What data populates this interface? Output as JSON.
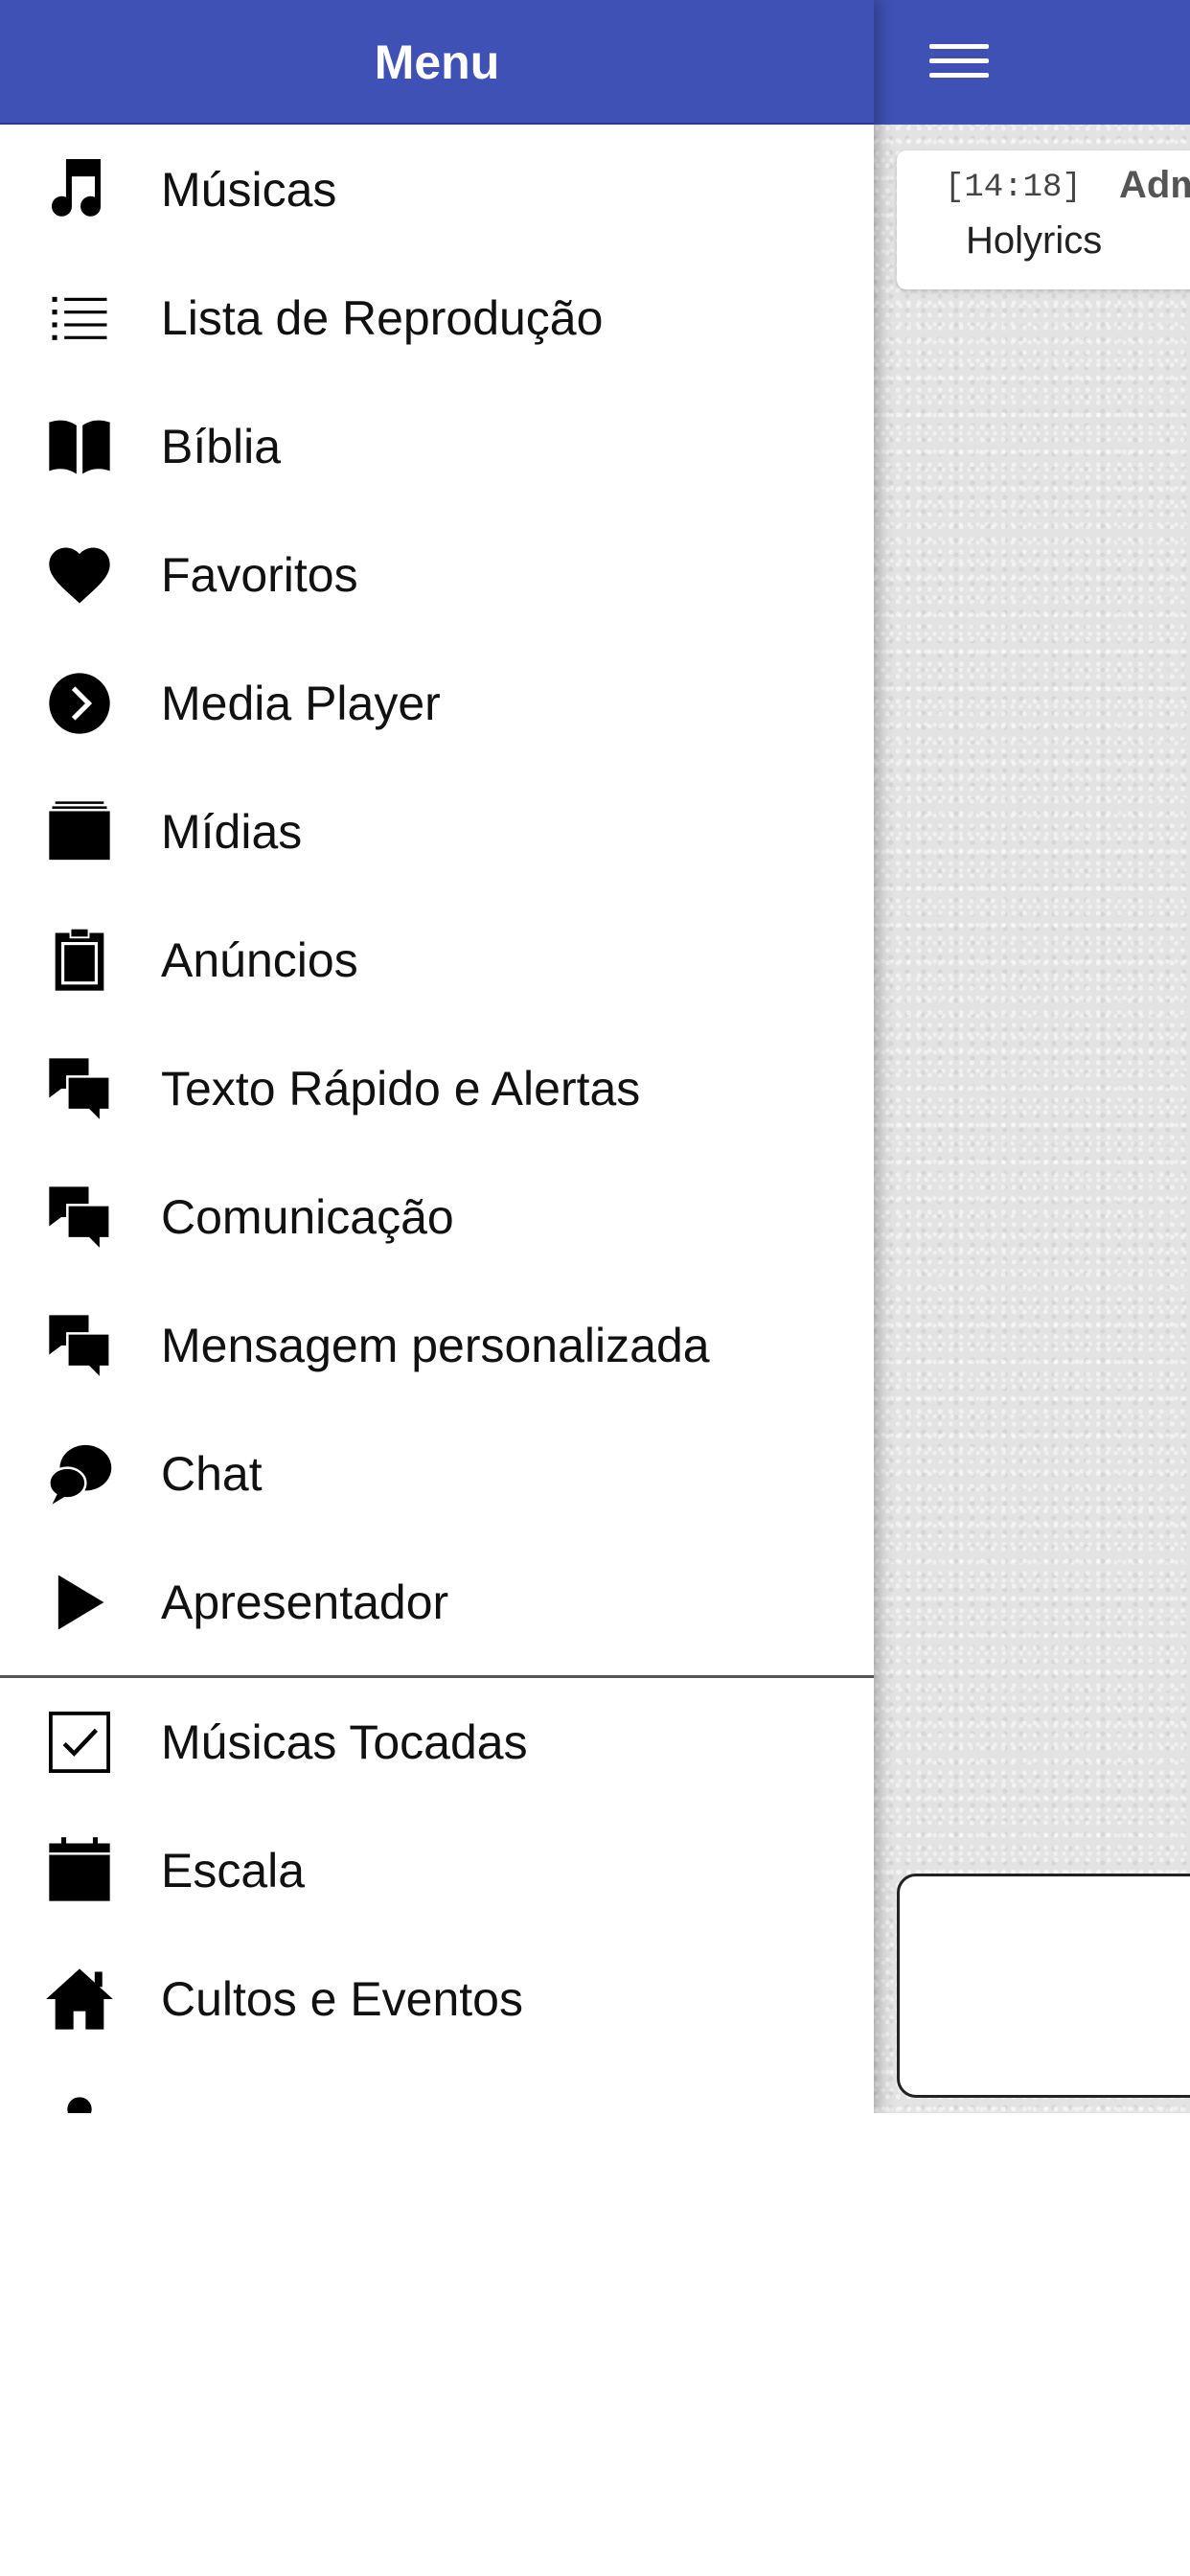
{
  "drawer": {
    "title": "Menu",
    "items": [
      {
        "label": "Músicas",
        "icon": "music-note-icon"
      },
      {
        "label": "Lista de Reprodução",
        "icon": "list-icon"
      },
      {
        "label": "Bíblia",
        "icon": "book-icon"
      },
      {
        "label": "Favoritos",
        "icon": "heart-icon"
      },
      {
        "label": "Media Player",
        "icon": "play-circle-icon"
      },
      {
        "label": "Mídias",
        "icon": "media-stack-icon"
      },
      {
        "label": "Anúncios",
        "icon": "clipboard-icon"
      },
      {
        "label": "Texto Rápido e Alertas",
        "icon": "chat-bubbles-icon"
      },
      {
        "label": "Comunicação",
        "icon": "chat-bubbles-icon"
      },
      {
        "label": "Mensagem personalizada",
        "icon": "chat-bubbles-icon"
      },
      {
        "label": "Chat",
        "icon": "chat-icon"
      },
      {
        "label": "Apresentador",
        "icon": "play-icon"
      },
      {
        "label": "Músicas Tocadas",
        "icon": "checkbox-icon"
      },
      {
        "label": "Escala",
        "icon": "calendar-icon"
      },
      {
        "label": "Cultos e Eventos",
        "icon": "home-icon"
      }
    ]
  },
  "chat": {
    "time": "[14:18]",
    "author": "Adm",
    "text": "Holyrics"
  },
  "colors": {
    "header": "#3f51b5",
    "background": "#e3e3e3"
  }
}
